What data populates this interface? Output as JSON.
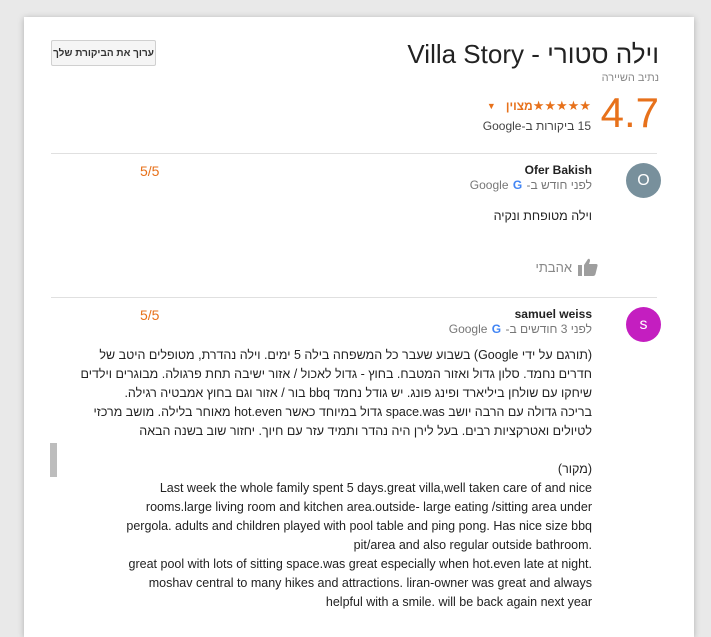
{
  "header": {
    "edit_button": "ערוך את הביקורת שלך",
    "title": "וילה סטורי - Villa Story",
    "subtitle": "נתיב השיירה",
    "rating": "4.7",
    "stars": "★★★★★",
    "rating_word": "מצוין",
    "review_count": "15 ביקורות ב-Google"
  },
  "reviews": [
    {
      "avatar_letter": "O",
      "avatar_color": "#78909c",
      "name": "Ofer Bakish",
      "time_prefix": "לפני חודש ב-",
      "source": "Google",
      "score": "5/5",
      "text": "וילה מטופחת ונקיה",
      "like_label": "אהבתי"
    },
    {
      "avatar_letter": "s",
      "avatar_color": "#c41ec0",
      "name": "samuel weiss",
      "time_prefix": "לפני 3 חודשים ב-",
      "source": "Google",
      "score": "5/5",
      "translated_lines": [
        "(תורגם על ידי Google) בשבוע שעבר כל המשפחה בילה 5 ימים. וילה נהדרת, מטופלים היטב של",
        "חדרים נחמד. סלון גדול ואזור המטבח. בחוץ - גדול לאכול / אזור ישיבה תחת פרגולה. מבוגרים וילדים",
        "שיחקו עם שולחן ביליארד ופינג פונג. יש גודל נחמד bbq בור / אזור וגם בחוץ אמבטיה רגילה.",
        "בריכה גדולה עם הרבה יושב space.was גדול במיוחד כאשר hot.even מאוחר בלילה. מושב מרכזי",
        "לטיולים ואטרקציות רבים. בעל לירן היה נהדר ותמיד עזר עם חיוך. יחזור שוב בשנה הבאה"
      ],
      "original_label": "(מקור)",
      "original_lines": [
        "Last week the whole family spent 5 days.great villa,well taken care of and nice",
        "rooms.large living room and kitchen area.outside- large eating /sitting area under",
        "pergola. adults and children played with pool table and ping pong. Has nice size bbq",
        "pit/area and also regular outside bathroom.",
        "great pool with lots of sitting space.was great especially when hot.even late at night.",
        "moshav central to many hikes and attractions. liran-owner was great and always",
        "helpful with a smile. will be back again next year"
      ]
    }
  ]
}
